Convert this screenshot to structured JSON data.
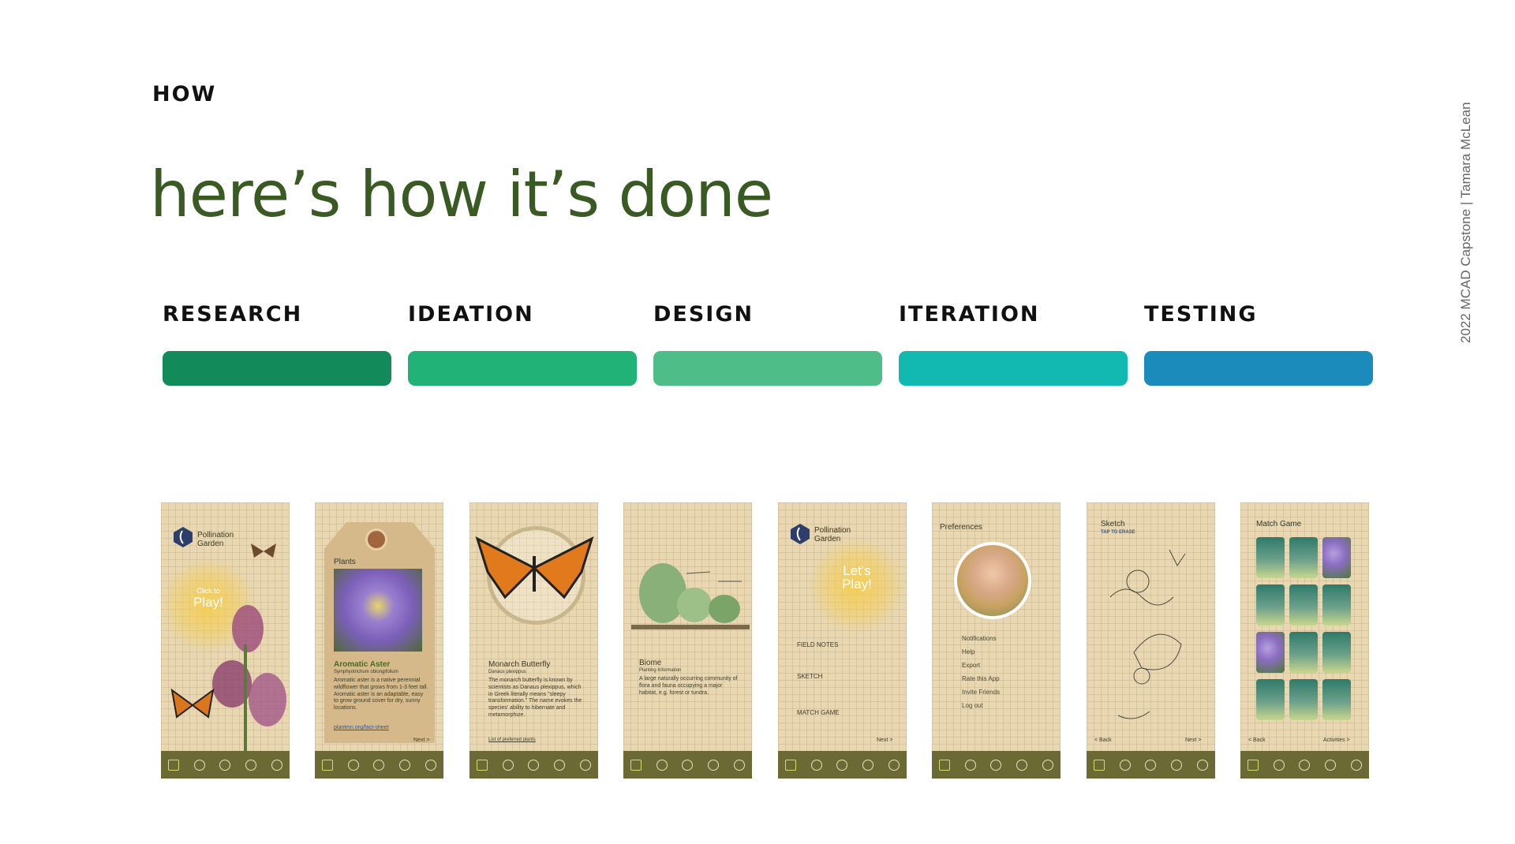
{
  "eyebrow": "HOW",
  "headline": "here’s how it’s done",
  "side_credit": "2022 MCAD Capstone | Tamara McLean",
  "stages": [
    {
      "label": "RESEARCH",
      "color": "#138a5a"
    },
    {
      "label": "IDEATION",
      "color": "#20b277"
    },
    {
      "label": "DESIGN",
      "color": "#4fbd88"
    },
    {
      "label": "ITERATION",
      "color": "#12b9b0"
    },
    {
      "label": "TESTING",
      "color": "#1a8bbb"
    }
  ],
  "screens": {
    "s1": {
      "app_name": "Pollination Garden",
      "cta_small": "Click to",
      "cta_big": "Play!"
    },
    "s2": {
      "section": "Plants",
      "plant_name": "Aromatic Aster",
      "latin": "Symphyotrichum oblongifolium",
      "desc": "Aromatic aster is a native perennial wildflower that grows from 1-3 feet tall. Aromatic aster is an adaptable, easy to grow ground cover for dry, sunny locations.",
      "link": "plantmn.org/fact-sheet",
      "next": "Next >"
    },
    "s3": {
      "title": "Monarch Butterfly",
      "latin": "Danaus plexippus",
      "desc": "The monarch butterfly is known by scientists as Danaus plexippus, which in Greek literally means \"sleepy transformation.\" The name evokes the species' ability to hibernate and metamorphize.",
      "link": "List of preferred plants"
    },
    "s4": {
      "title": "Biome",
      "subtitle": "Planting Information",
      "desc": "A large naturally occurring community of flora and fauna occupying a major habitat, e.g. forest or tundra."
    },
    "s5": {
      "app_name": "Pollination Garden",
      "cta": "Let's Play!",
      "notes": [
        "FIELD NOTES",
        "SKETCH",
        "MATCH GAME"
      ],
      "next": "Next >"
    },
    "s6": {
      "title": "Preferences",
      "menu": [
        "Notifications",
        "Help",
        "Export",
        "Rate this App",
        "Invite Friends",
        "Log out"
      ]
    },
    "s7": {
      "title": "Sketch",
      "hint": "TAP TO ERASE",
      "back": "< Back",
      "next": "Next >"
    },
    "s8": {
      "title": "Match Game",
      "back": "< Back",
      "activities": "Activities >"
    }
  }
}
